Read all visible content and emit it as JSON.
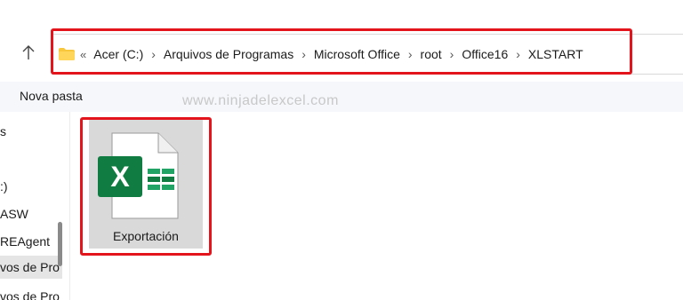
{
  "address_bar": {
    "overflow_label": "«",
    "crumbs": [
      "Acer (C:)",
      "Arquivos de Programas",
      "Microsoft Office",
      "root",
      "Office16",
      "XLSTART"
    ]
  },
  "toolbar": {
    "new_folder_label": "Nova pasta"
  },
  "watermark": "www.ninjadelexcel.com",
  "nav": {
    "items": [
      {
        "label": "s"
      },
      {
        "label": ":)"
      },
      {
        "label": "ASW"
      },
      {
        "label": "REAgent"
      },
      {
        "label": "vos de Pro"
      },
      {
        "label": "vos de Pro"
      }
    ]
  },
  "files": [
    {
      "name": "Exportación",
      "icon": "excel-file-icon",
      "selected": true
    }
  ],
  "colors": {
    "highlight": "#e4141c",
    "excel_green": "#107c41",
    "folder_yellow": "#f8c73c"
  }
}
